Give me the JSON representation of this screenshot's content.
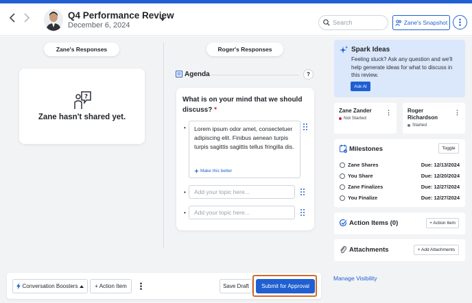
{
  "header": {
    "title": "Q4 Performance Review",
    "date": "December 6, 2024",
    "back_icon": "chevron-left-icon",
    "forward_icon": "chevron-right-icon",
    "search_placeholder": "Search",
    "snapshot_label": "Zane's Snapshot",
    "accent": "#1f5fd1"
  },
  "responses": {
    "left_tab": "Zane's Responses",
    "right_tab": "Roger's Responses",
    "empty_message": "Zane hasn't shared yet."
  },
  "agenda": {
    "label": "Agenda",
    "help": "?",
    "question": "What is on your mind that we should discuss?",
    "required_mark": "*",
    "topic_text": "Lorem ipsum odor amet, consectetuer adipiscing elit. Finibus aenean turpis turpis sagittis sagittis tellus fringilla dis.",
    "make_better": "Make this better",
    "topic_placeholder": "Add your topic here..."
  },
  "footer": {
    "boosters_label": "Conversation Boosters",
    "action_item_label": "+ Action Item",
    "save_draft_label": "Save Draft",
    "submit_label": "Submit for Approval"
  },
  "spark": {
    "title": "Spark Ideas",
    "text": "Feeling stuck? Ask any question and we'll help generate ideas for what to discuss in this review.",
    "ask_label": "Ask AI"
  },
  "participants": [
    {
      "name": "Zane Zander",
      "status": "Not Started",
      "status_color": "#d21f3c"
    },
    {
      "name": "Roger Richardson",
      "status": "Started",
      "status_color": "#6b7280"
    }
  ],
  "milestones": {
    "title": "Milestones",
    "toggle_label": "Toggle",
    "items": [
      {
        "name": "Zane Shares",
        "due": "Due: 12/13/2024"
      },
      {
        "name": "You Share",
        "due": "Due: 12/20/2024"
      },
      {
        "name": "Zane Finalizes",
        "due": "Due: 12/27/2024"
      },
      {
        "name": "You Finalize",
        "due": "Due: 12/27/2024"
      }
    ]
  },
  "action_items": {
    "title": "Action Items (0)",
    "button": "+ Action Item"
  },
  "attachments": {
    "title": "Attachments",
    "button": "+ Add Attachments"
  },
  "manage_visibility": "Manage Visibility"
}
